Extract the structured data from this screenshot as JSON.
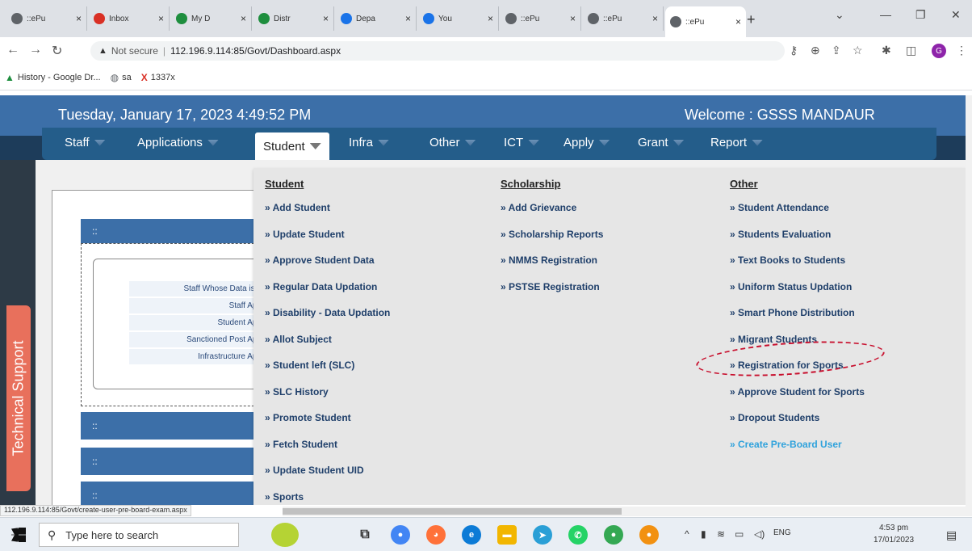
{
  "browser": {
    "tabs": [
      {
        "title": "::ePu",
        "favicon": "globe-icon",
        "color": "#5f6368"
      },
      {
        "title": "Inbox",
        "favicon": "gmail-icon",
        "color": "#d93025"
      },
      {
        "title": "My D",
        "favicon": "drive-icon",
        "color": "#1e8e3e"
      },
      {
        "title": "Distr",
        "favicon": "sheets-icon",
        "color": "#1e8e3e"
      },
      {
        "title": "Depa",
        "favicon": "sites-icon",
        "color": "#1a73e8"
      },
      {
        "title": "You",
        "favicon": "sites-icon",
        "color": "#1a73e8"
      },
      {
        "title": "::ePu",
        "favicon": "globe-icon",
        "color": "#5f6368"
      },
      {
        "title": "::ePu",
        "favicon": "globe-icon",
        "color": "#5f6368"
      },
      {
        "title": "::ePu",
        "favicon": "globe-icon",
        "color": "#5f6368",
        "active": true
      }
    ],
    "address": {
      "security": "Not secure",
      "url": "112.196.9.114:85/Govt/Dashboard.aspx"
    },
    "bookmarks": [
      {
        "label": "History - Google Dr...",
        "icon": "drive-icon"
      },
      {
        "label": "sa",
        "icon": "globe-icon"
      },
      {
        "label": "1337x",
        "icon": "x-icon"
      }
    ],
    "profile_initial": "G"
  },
  "header": {
    "datetime": "Tuesday, January 17, 2023 4:49:52 PM",
    "welcome": "Welcome : GSSS MANDAUR"
  },
  "nav": {
    "items": [
      {
        "label": "Staff"
      },
      {
        "label": "Applications"
      },
      {
        "label": "Student",
        "active": true
      },
      {
        "label": "Infra"
      },
      {
        "label": "Other"
      },
      {
        "label": "ICT"
      },
      {
        "label": "Apply"
      },
      {
        "label": "Grant"
      },
      {
        "label": "Report"
      }
    ]
  },
  "dropdown": {
    "columns": [
      {
        "heading": "Student",
        "items": [
          "» Add Student",
          "» Update Student",
          "» Approve Student Data",
          "» Regular Data Updation",
          "» Disability - Data Updation",
          "» Allot Subject",
          "» Student left (SLC)",
          "» SLC History",
          "» Promote Student",
          "» Fetch Student",
          "» Update Student UID",
          "» Sports"
        ]
      },
      {
        "heading": "Scholarship",
        "items": [
          "» Add Grievance",
          "» Scholarship Reports",
          "» NMMS Registration",
          "» PSTSE Registration"
        ]
      },
      {
        "heading": "Other",
        "items": [
          "» Student Attendance",
          "» Students Evaluation",
          "» Text Books to Students",
          "» Uniform Status Updation",
          "» Smart Phone Distribution",
          "» Migrant Students",
          "» Registration for Sports",
          "» Approve Student for Sports",
          "» Dropout Students",
          "» Create Pre-Board User"
        ],
        "highlighted": "» Create Pre-Board User"
      }
    ]
  },
  "dashboard": {
    "bar_glyph": "::",
    "stat_labels": [
      "Staff Whose Data is n",
      "Staff App",
      "Student App",
      "Sanctioned Post App",
      "Infrastructure App"
    ]
  },
  "tech_support": "Technical Support",
  "status_url": "112.196.9.114:85/Govt/create-user-pre-board-exam.aspx",
  "taskbar": {
    "search_placeholder": "Type here to search",
    "language": "ENG",
    "time": "4:53 pm",
    "date": "17/01/2023"
  }
}
